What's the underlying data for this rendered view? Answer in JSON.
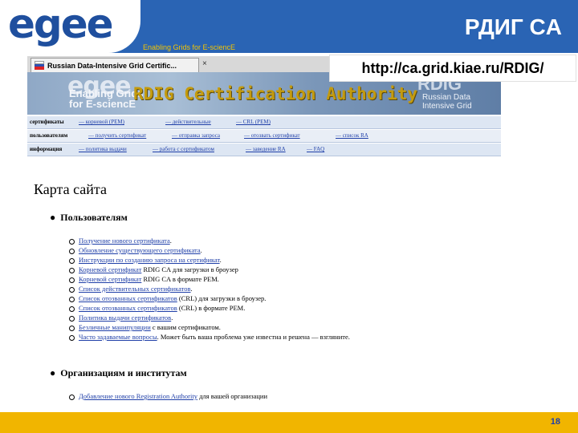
{
  "header": {
    "logo": "egee",
    "tagline": "Enabling Grids for E-sciencE",
    "title": "РДИГ CA"
  },
  "url_label": "http://ca.grid.kiae.ru/RDIG/",
  "browser": {
    "tab_title": "Russian Data-Intensive Grid Certific...",
    "tab_close": "×"
  },
  "banner": {
    "egee": "egee",
    "enabling_1": "Enabling Grids",
    "enabling_2": "for E-sciencE",
    "title": "RDIG Certification Authority",
    "rdig": "RDIG",
    "rdig_sub_1": "Russian Data",
    "rdig_sub_2": "Intensive Grid"
  },
  "nav": {
    "row1": {
      "label": "сертификаты",
      "items": [
        "— корневой (PEM)",
        "— действительные",
        "— CRL (PEM)"
      ]
    },
    "row2": {
      "label": "пользователям",
      "items": [
        "— получить сертификат",
        "— отправка запроса",
        "— отозвать сертификат",
        "— список RA"
      ]
    },
    "row3": {
      "label": "информация",
      "items": [
        "— политика выдачи",
        "— работа с сертификатом",
        "— заведение RA",
        "— FAQ"
      ]
    }
  },
  "sitemap": {
    "title": "Карта сайта",
    "section1": {
      "heading": "Пользователям",
      "items": [
        {
          "link": "Получение нового сертификата",
          "text": "."
        },
        {
          "link": "Обновление существующего сертификата",
          "text": "."
        },
        {
          "link": "Инструкции по созданию запроса на сертификат",
          "text": "."
        },
        {
          "link": "Корневой сертификат",
          "text": " RDIG CA для загрузки в броузер"
        },
        {
          "link": "Корневой сертификат",
          "text": " RDIG CA в формате PEM."
        },
        {
          "link": "Список действительных сертификатов",
          "text": "."
        },
        {
          "link": "Список отозванных сертификатов",
          "text": " (CRL) для загрузки в броузер."
        },
        {
          "link": "Список отозванных сертификатов",
          "text": " (CRL) в формате PEM."
        },
        {
          "link": "Политика выдачи сертификатов",
          "text": "."
        },
        {
          "link": "Безличные манипуляции",
          "text": " с вашим сертификатом."
        },
        {
          "link": "Часто задаваемые вопросы",
          "text": ". Может быть ваша проблема уже известна и решена — взгляните."
        }
      ]
    },
    "section2": {
      "heading": "Организациям и институтам",
      "items": [
        {
          "link": "Добавление нового Registration Authority",
          "text": " для вашей организации"
        }
      ]
    }
  },
  "footer": {
    "page_number": "18"
  },
  "colors": {
    "header_blue": "#2a64b4",
    "footer_gold": "#f1b500",
    "link_blue": "#1f3fa8",
    "banner_gold": "#c49b0e"
  }
}
